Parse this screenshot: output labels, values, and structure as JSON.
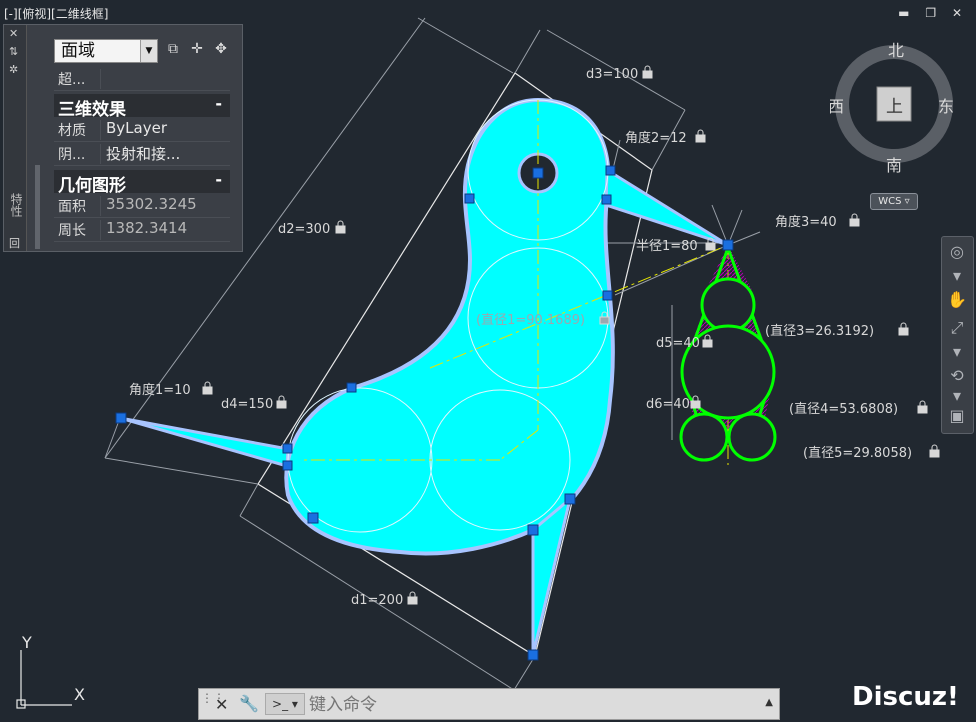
{
  "viewport": {
    "label": "[-][俯视][二维线框]"
  },
  "window_controls": {
    "minimize": "▬",
    "restore": "❐",
    "close": "✕"
  },
  "properties": {
    "strip_title": "特性",
    "strip_icon_bottom": "回",
    "object_type": "面域",
    "rows_top": [
      {
        "key": "超...",
        "value": ""
      }
    ],
    "sections": [
      {
        "title": "三维效果",
        "collapse": "-",
        "rows": [
          {
            "key": "材质",
            "value": "ByLayer"
          },
          {
            "key": "阴...",
            "value": "投射和接..."
          }
        ]
      },
      {
        "title": "几何图形",
        "collapse": "-",
        "rows": [
          {
            "key": "面积",
            "value": "35302.3245"
          },
          {
            "key": "周长",
            "value": "1382.3414"
          }
        ]
      }
    ]
  },
  "viewcube": {
    "north": "北",
    "south": "南",
    "east": "东",
    "west": "西",
    "face": "上",
    "wcs": "WCS"
  },
  "dimensions": {
    "d1": "d1=200",
    "d2": "d2=300",
    "d3": "d3=100",
    "d4": "d4=150",
    "d5": "d5=40",
    "d6": "d6=40",
    "angle1": "角度1=10",
    "angle2": "角度2=12",
    "angle3": "角度3=40",
    "radius1": "半径1=80",
    "diameter1": "(直径1=90.1689)",
    "diameter3": "(直径3=26.3192)",
    "diameter4": "(直径4=53.6808)",
    "diameter5": "(直径5=29.8058)"
  },
  "ucs": {
    "x": "X",
    "y": "Y"
  },
  "command_line": {
    "placeholder": "键入命令"
  },
  "watermark": "Discuz!",
  "colors": {
    "background": "#212830",
    "region_fill": "#00ffff",
    "grip": "#1a6fe0",
    "green": "#00ff00",
    "hatch": "#aa00aa",
    "centerline": "#e6e600"
  }
}
